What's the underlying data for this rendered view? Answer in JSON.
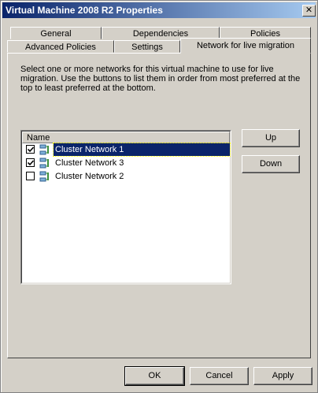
{
  "window": {
    "title": "Virtual Machine 2008 R2 Properties",
    "close_glyph": "✕"
  },
  "tabs": {
    "row_back": [
      "General",
      "Dependencies",
      "Policies"
    ],
    "row_front": [
      "Advanced Policies",
      "Settings",
      "Network for live migration"
    ],
    "active": "Network for live migration"
  },
  "description": "Select one or more networks for this virtual machine to use for live migration. Use the buttons to list them in order from most preferred at the top to least preferred at the bottom.",
  "list": {
    "column_header": "Name",
    "items": [
      {
        "label": "Cluster Network 1",
        "checked": true,
        "selected": true,
        "icon": "cluster-network-icon"
      },
      {
        "label": "Cluster Network 3",
        "checked": true,
        "selected": false,
        "icon": "cluster-network-icon"
      },
      {
        "label": "Cluster Network 2",
        "checked": false,
        "selected": false,
        "icon": "cluster-network-icon"
      }
    ]
  },
  "side_buttons": {
    "up": "Up",
    "down": "Down"
  },
  "footer": {
    "ok": "OK",
    "cancel": "Cancel",
    "apply": "Apply"
  },
  "colors": {
    "title_start": "#0a246a",
    "title_end": "#a6caf0",
    "selection": "#0a246a",
    "face": "#d4d0c8"
  }
}
